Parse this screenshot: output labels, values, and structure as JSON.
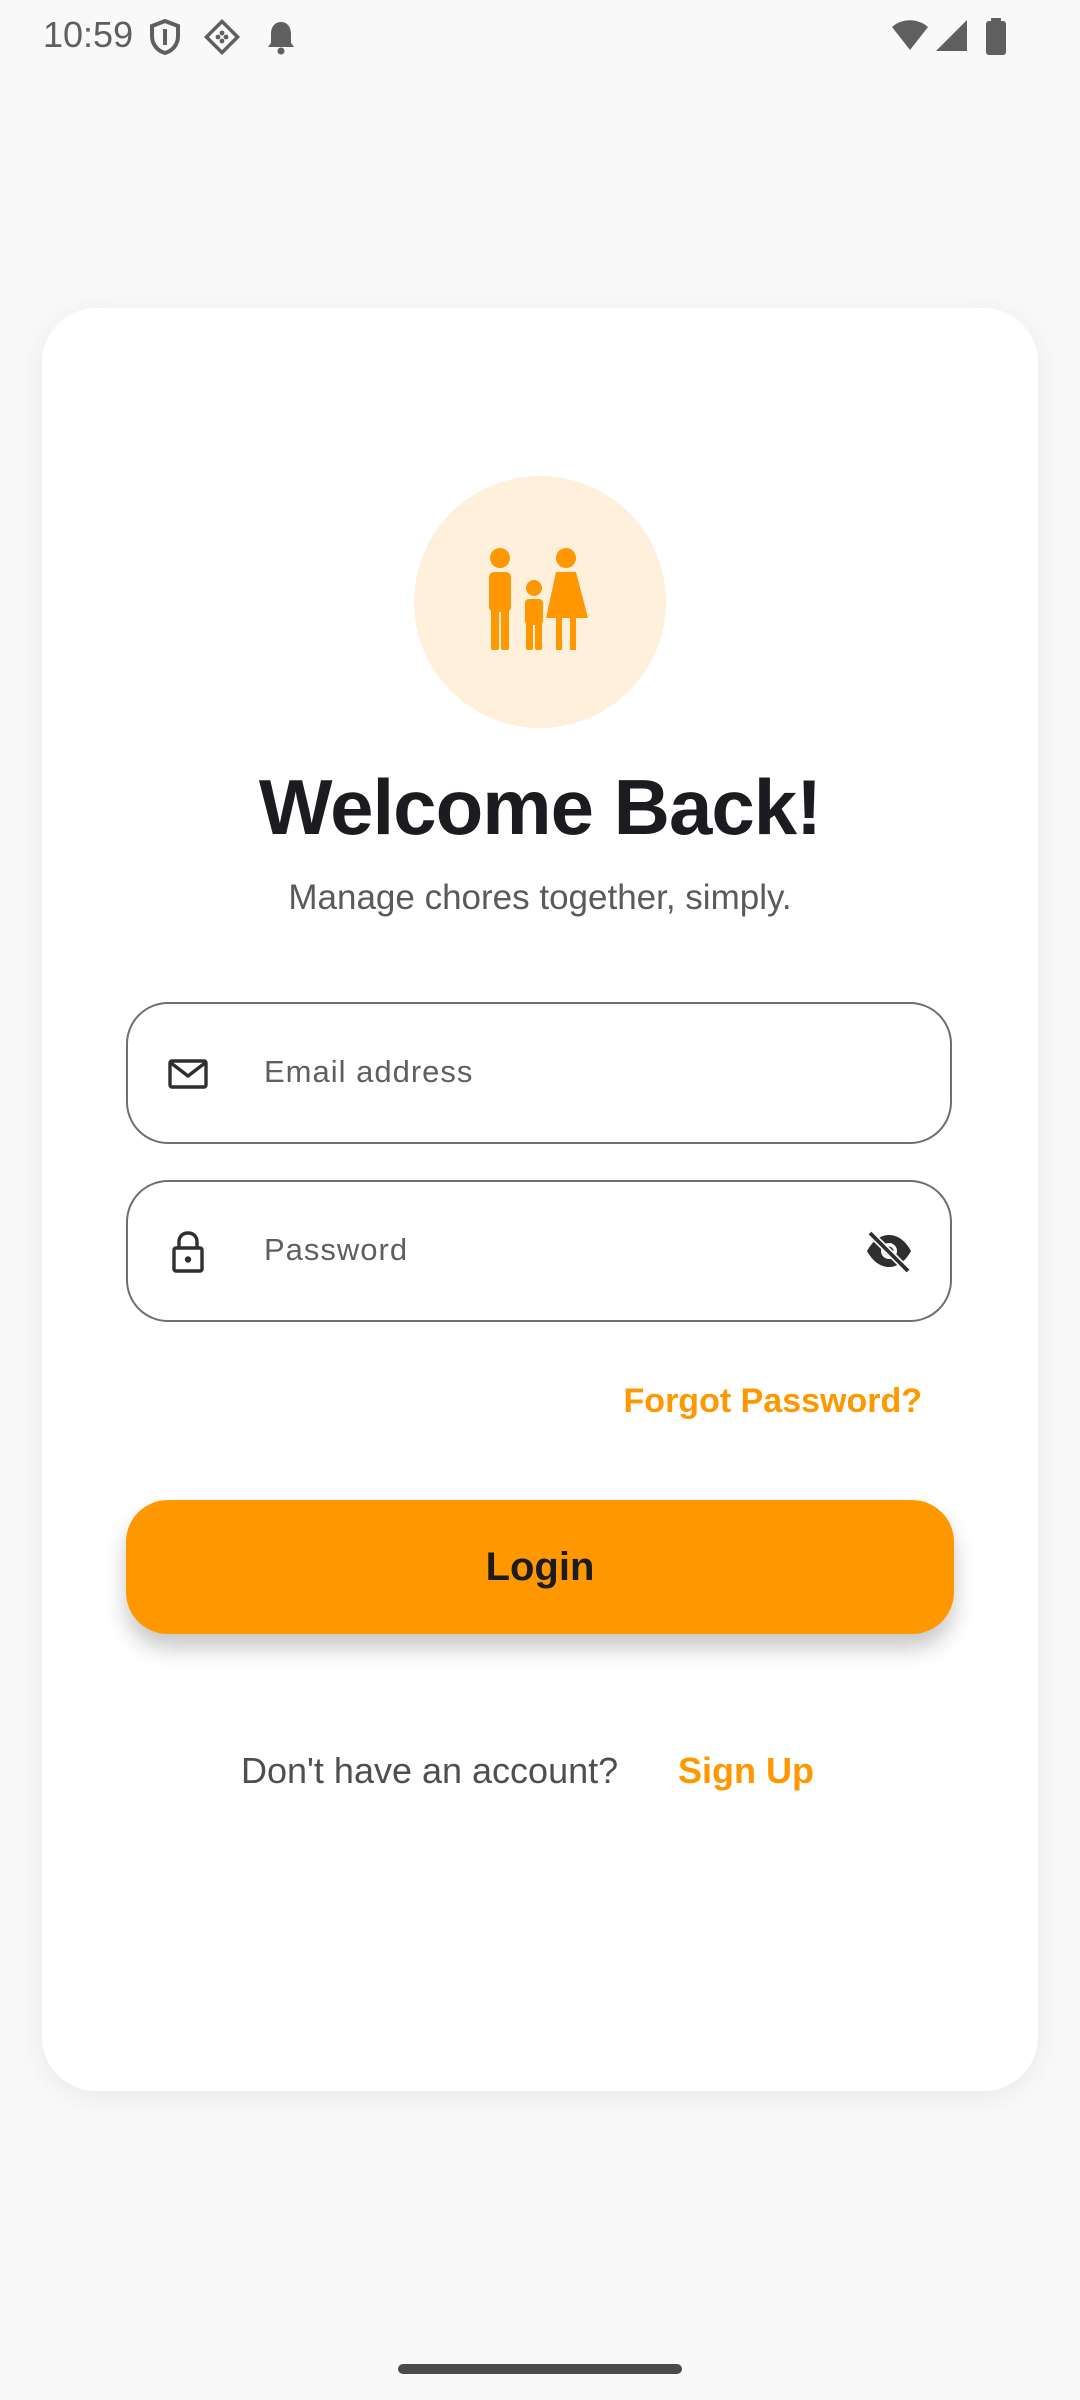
{
  "status_bar": {
    "time": "10:59",
    "icons": [
      "shield-icon",
      "diamond-grid-icon",
      "bell-icon",
      "wifi-icon",
      "signal-icon",
      "battery-icon"
    ]
  },
  "header": {
    "logo_icon": "family-icon",
    "title": "Welcome Back!",
    "subtitle": "Manage chores together, simply."
  },
  "form": {
    "email": {
      "icon": "mail-icon",
      "placeholder": "Email address",
      "value": ""
    },
    "password": {
      "icon": "lock-icon",
      "placeholder": "Password",
      "value": "",
      "visibility_icon": "eye-off-icon"
    },
    "forgot_password_label": "Forgot Password?",
    "login_label": "Login"
  },
  "footer": {
    "prompt": "Don't have an account?",
    "signup_label": "Sign Up"
  },
  "colors": {
    "accent": "#ff9800",
    "accent_light": "#fff0dc",
    "background": "#f9f9f9",
    "card": "#ffffff",
    "text_primary": "#1c1b1f",
    "text_secondary": "#5a5a5a"
  }
}
